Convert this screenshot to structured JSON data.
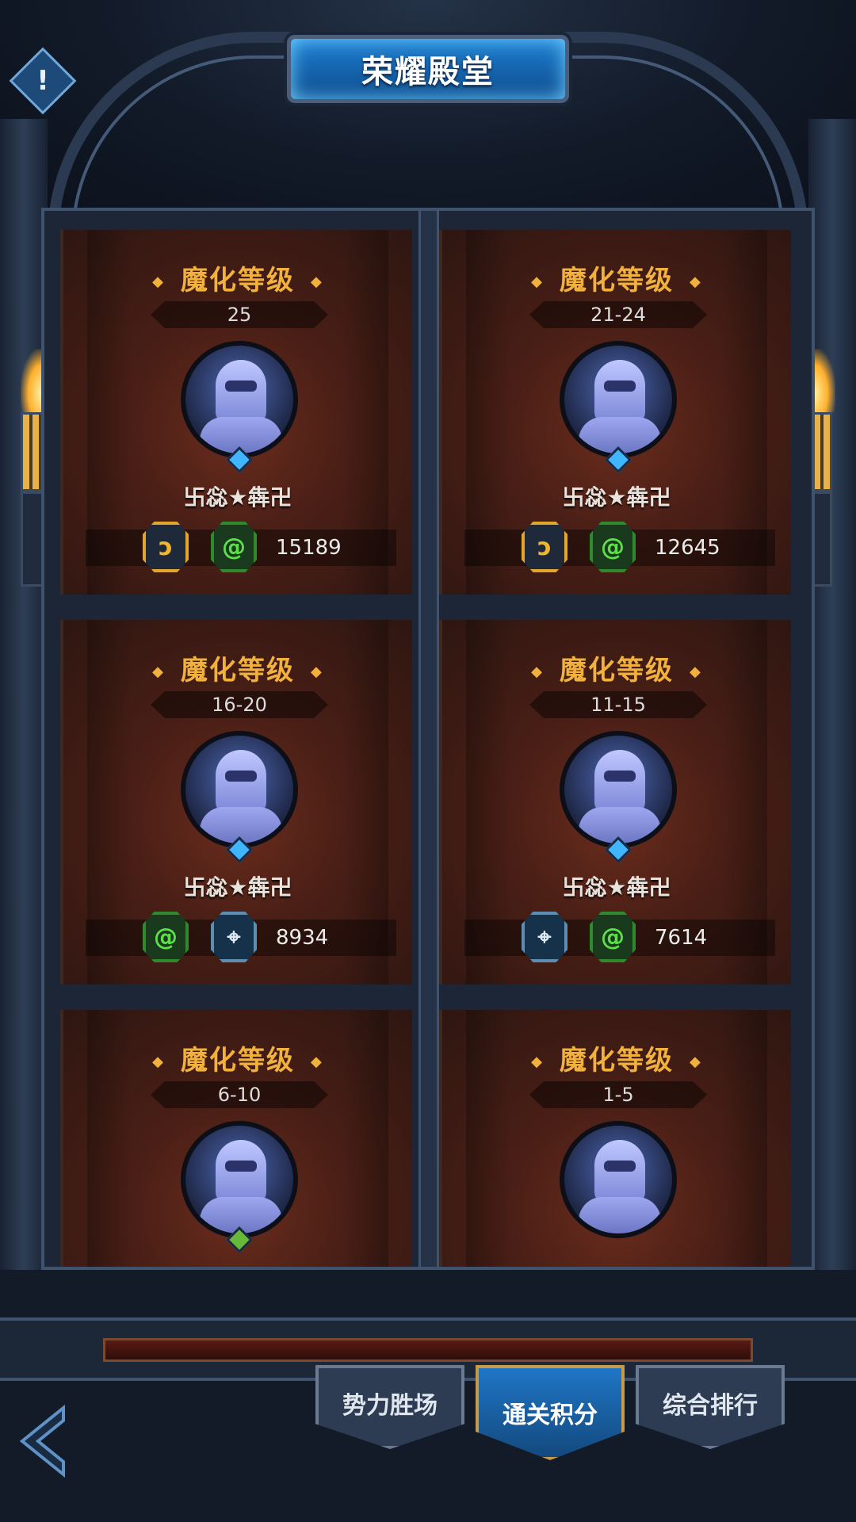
{
  "header": {
    "title": "荣耀殿堂",
    "info_icon_glyph": "!"
  },
  "cards": [
    {
      "title": "魔化等级",
      "range": "25",
      "name": "卐惢★犇卍",
      "icons": [
        "gold-hook",
        "green-swirl"
      ],
      "score": "15189",
      "gem": "blue"
    },
    {
      "title": "魔化等级",
      "range": "21-24",
      "name": "卐惢★犇卍",
      "icons": [
        "gold-hook",
        "green-swirl"
      ],
      "score": "12645",
      "gem": "blue"
    },
    {
      "title": "魔化等级",
      "range": "16-20",
      "name": "卐惢★犇卍",
      "icons": [
        "green-swirl",
        "target"
      ],
      "score": "8934",
      "gem": "blue"
    },
    {
      "title": "魔化等级",
      "range": "11-15",
      "name": "卐惢★犇卍",
      "icons": [
        "target",
        "green-swirl"
      ],
      "score": "7614",
      "gem": "blue"
    },
    {
      "title": "魔化等级",
      "range": "6-10",
      "gem": "green"
    },
    {
      "title": "魔化等级",
      "range": "1-5"
    }
  ],
  "tabs": [
    {
      "label": "势力胜场",
      "active": false
    },
    {
      "label": "通关积分",
      "active": true
    },
    {
      "label": "综合排行",
      "active": false
    }
  ],
  "icon_glyphs": {
    "gold-hook": "ↄ",
    "green-swirl": "@",
    "target": "⌖"
  },
  "colors": {
    "accent_gold": "#f1b13b",
    "active_tab": "#1f76c6",
    "card_bg": "#4a1f16"
  }
}
